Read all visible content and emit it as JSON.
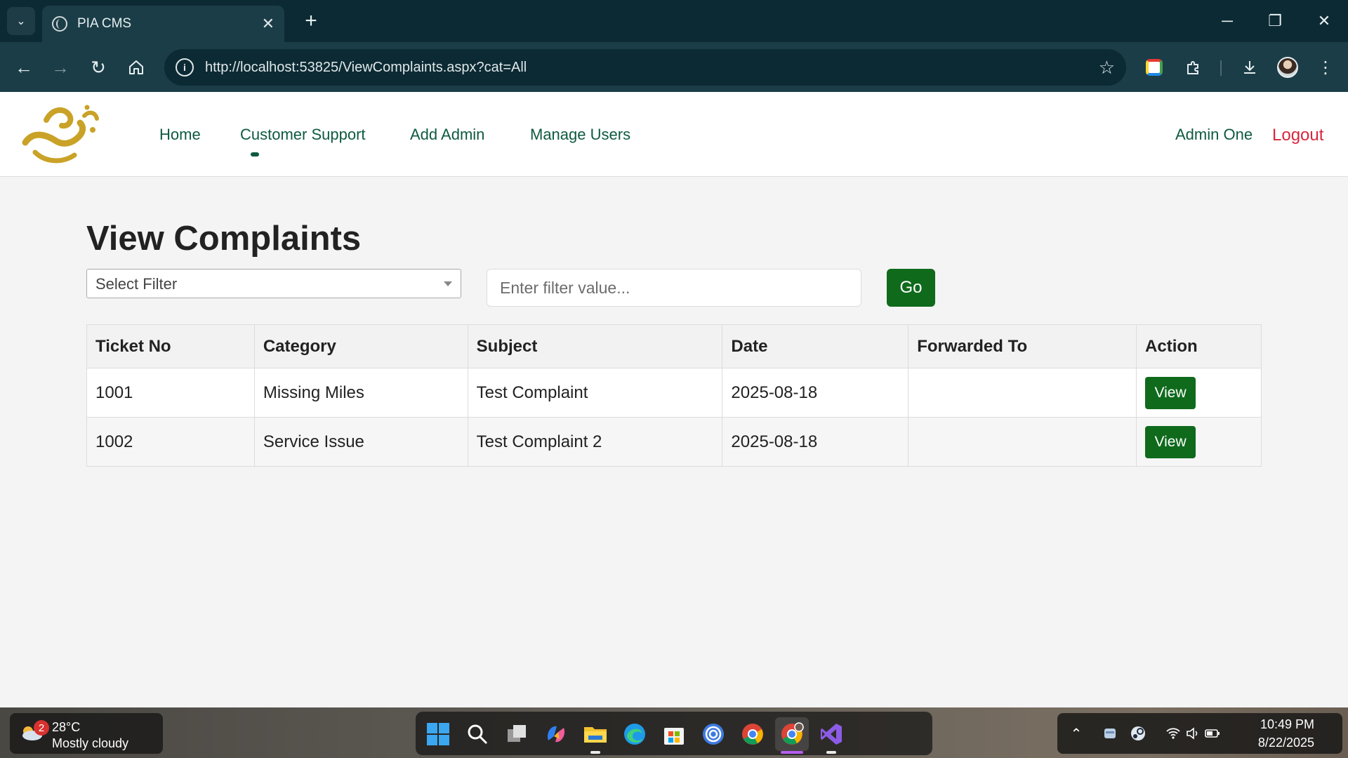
{
  "browser": {
    "tab_title": "PIA CMS",
    "tab_close": "✕",
    "new_tab": "+",
    "url": "http://localhost:53825/ViewComplaints.aspx?cat=All"
  },
  "header": {
    "nav": [
      "Home",
      "Customer Support",
      "Add Admin",
      "Manage Users"
    ],
    "active_nav": "Customer Support",
    "user_name": "Admin One",
    "logout": "Logout"
  },
  "main": {
    "title": "View Complaints",
    "filter_select": "Select Filter",
    "filter_placeholder": "Enter filter value...",
    "go_label": "Go",
    "table": {
      "headers": [
        "Ticket No",
        "Category",
        "Subject",
        "Date",
        "Forwarded To",
        "Action"
      ],
      "rows": [
        {
          "ticket": "1001",
          "category": "Missing Miles",
          "subject": "Test Complaint",
          "date": "2025-08-18",
          "forwarded_to": "",
          "action": "View"
        },
        {
          "ticket": "1002",
          "category": "Service Issue",
          "subject": "Test Complaint 2",
          "date": "2025-08-18",
          "forwarded_to": "",
          "action": "View"
        }
      ]
    }
  },
  "taskbar": {
    "weather_badge": "2",
    "temperature": "28°C",
    "condition": "Mostly cloudy",
    "time": "10:49 PM",
    "date": "8/22/2025",
    "apps": [
      "windows-start-icon",
      "search-icon",
      "task-view-icon",
      "copilot-icon",
      "file-explorer-icon",
      "edge-icon",
      "ms-store-icon",
      "airdrop-icon",
      "chrome-icon",
      "chrome-profile-icon",
      "visual-studio-icon"
    ]
  },
  "colors": {
    "brand_green": "#0e5a3f",
    "button_green": "#0f6a1c",
    "logout_red": "#d9263d",
    "logo_gold": "#c9a227",
    "chrome_dark": "#0c2a33",
    "chrome_toolbar": "#1b3d47"
  }
}
